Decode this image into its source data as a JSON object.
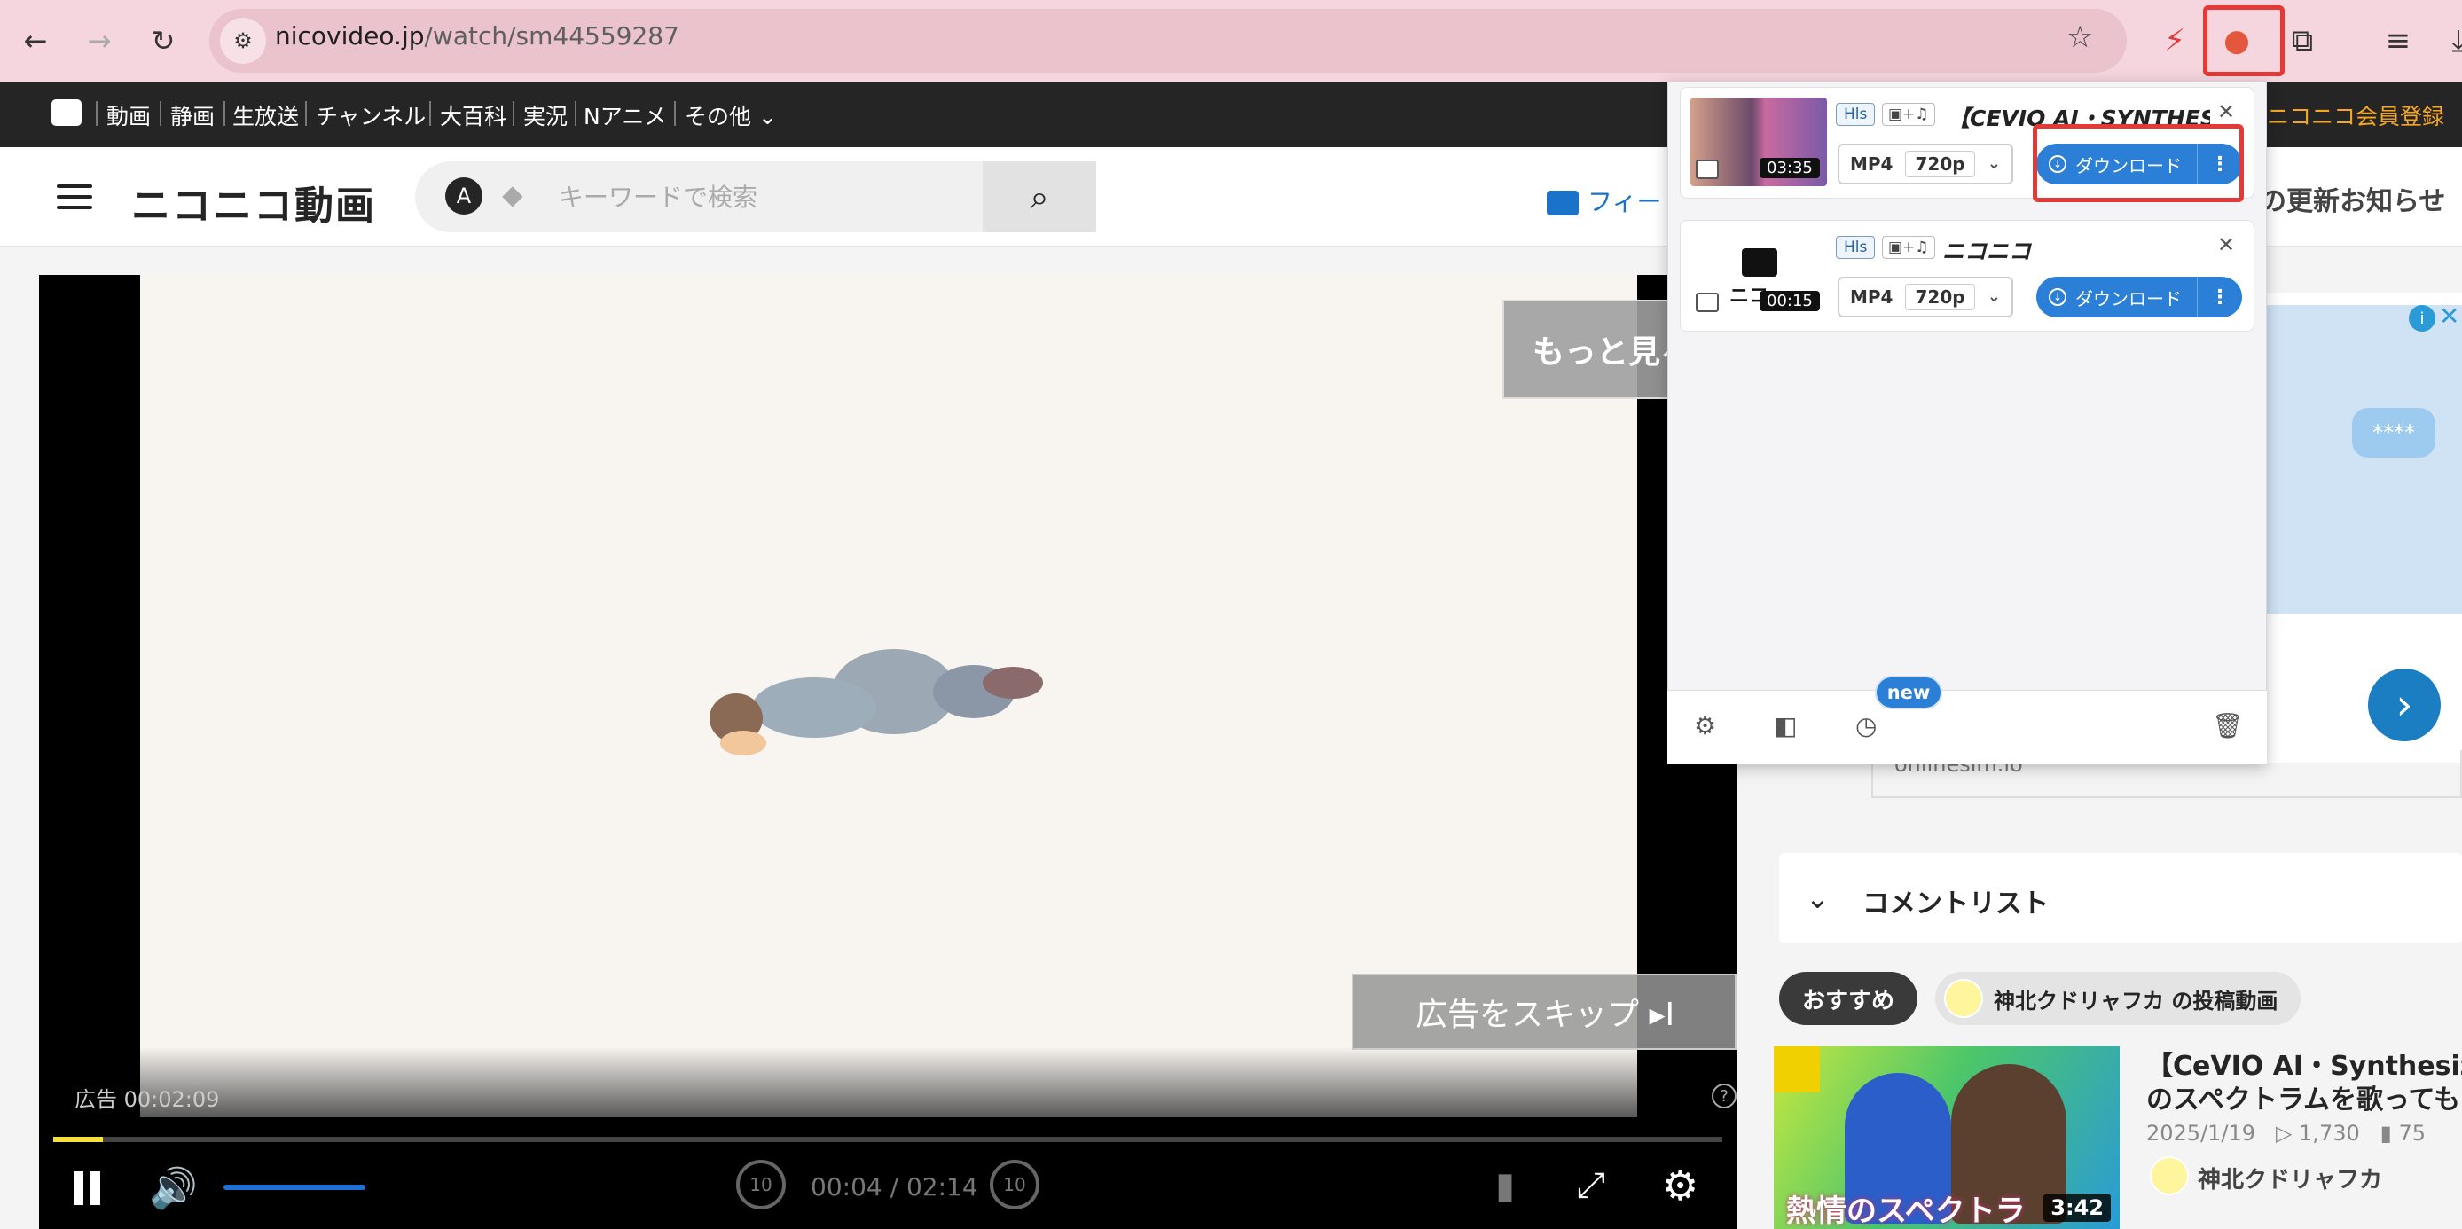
{
  "browser": {
    "back_icon": "←",
    "forward_icon": "→",
    "reload_icon": "↻",
    "site_info_icon": "⚙",
    "url_host": "nicovideo.jp",
    "url_path": "/watch/sm44559287",
    "star_icon": "☆",
    "bolt_icon": "⚡",
    "ext_icon": "●",
    "puzzle_icon": "⧉",
    "queue_icon": "≡",
    "download_icon": "⤓"
  },
  "topbar": {
    "items": [
      "動画",
      "静画",
      "生放送",
      "チャンネル",
      "大百科",
      "実況",
      "Nアニメ",
      "その他 ⌄"
    ],
    "register": "ニコニコ会員登録"
  },
  "header": {
    "logo": "ニコニコ動画",
    "search_a": "A",
    "search_tag": "⬥",
    "search_placeholder": "キーワードで検索",
    "search_icon": "⌕",
    "mail_label": "フィー",
    "update_link": "の更新お知らせ"
  },
  "player": {
    "more_button": "もっと見る",
    "skip_button": "広告をスキップ ▸I",
    "ad_time": "広告 00:02:09",
    "help": "?",
    "progress": 0.03,
    "volume_icon": "🔊",
    "skip_back": "10",
    "skip_fwd": "10",
    "time_current": "00:04",
    "time_total": "02:14",
    "comment_icon": "▮",
    "fullscreen_icon": "⤢",
    "settings_icon": "⚙"
  },
  "ad": {
    "bubble": "****",
    "info": "i",
    "close": "✕",
    "arrow": "›",
    "url": "onlinesim.io"
  },
  "comments": {
    "chevron": "⌄",
    "title": "コメントリスト"
  },
  "recommend": {
    "tab_recommend": "おすすめ",
    "tab_author": "神北クドリャフカ の投稿動画",
    "title_line1": "【CeVIO AI・SynthesizerV",
    "title_line2": "のスペクトラムを歌ってもら",
    "date": "2025/1/19",
    "views": "▷ 1,730",
    "comments": "▮ 75",
    "author": "神北クドリャフカ",
    "thumb_caption": "熱情のスペクトラ",
    "duration": "3:42"
  },
  "popup": {
    "items": [
      {
        "duration": "03:35",
        "tag_hls": "Hls",
        "tag_av": "▣+♫",
        "title": "【CEVIO AI・SYNTHES...",
        "close": "✕",
        "format": "MP4",
        "quality": "720p",
        "download": "ダウンロード",
        "more": "⋮"
      },
      {
        "duration": "00:15",
        "tag_hls": "Hls",
        "tag_av": "▣+♫",
        "title": "ニコニコ",
        "close": "✕",
        "format": "MP4",
        "quality": "720p",
        "download": "ダウンロード",
        "more": "⋮"
      }
    ],
    "thumb2_text": "ニコ",
    "new_badge": "new",
    "footer": {
      "settings": "⚙",
      "sidepanel": "◧",
      "history": "◷",
      "trash": "🗑"
    }
  }
}
